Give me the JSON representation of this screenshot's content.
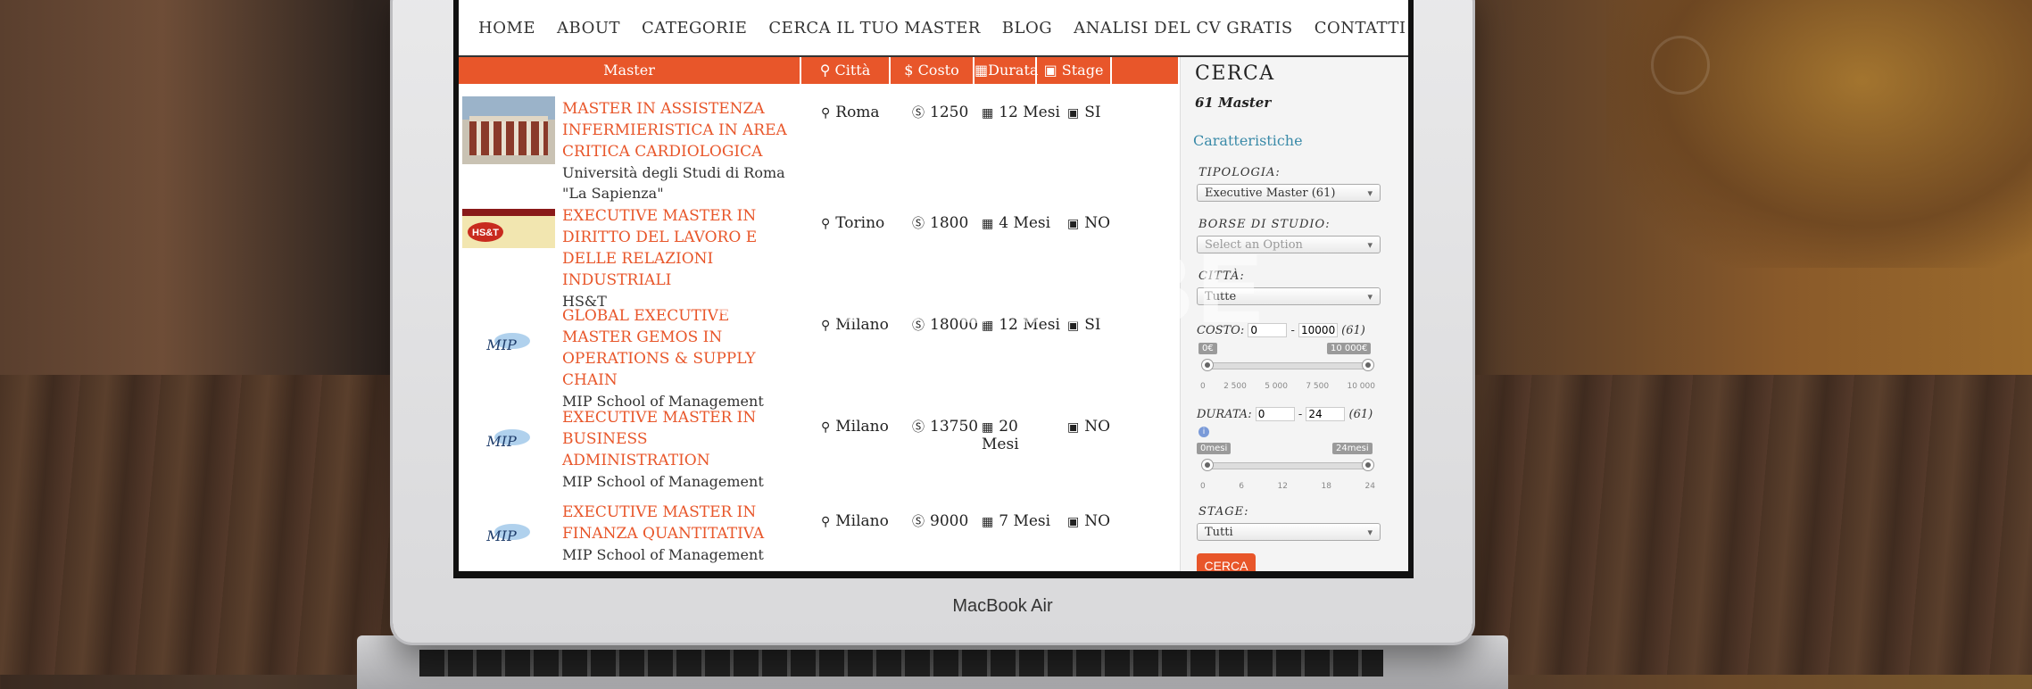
{
  "nav": [
    "HOME",
    "ABOUT",
    "CATEGORIE",
    "CERCA IL TUO MASTER",
    "BLOG",
    "ANALISI DEL CV GRATIS",
    "CONTATTI"
  ],
  "table_header": {
    "master": "Master",
    "city": "Città",
    "cost": "Costo",
    "duration": "Durata",
    "stage": "Stage"
  },
  "rows": [
    {
      "title": "MASTER IN ASSISTENZA INFERMIERISTICA IN AREA CRITICA CARDIOLOGICA",
      "org": "Università degli Studi di Roma \"La Sapienza\"",
      "city": "Roma",
      "cost": "1250",
      "duration": "12 Mesi",
      "stage": "SI",
      "logo": "building-photo"
    },
    {
      "title": "EXECUTIVE MASTER IN DIRITTO DEL LAVORO E DELLE RELAZIONI INDUSTRIALI",
      "org": "HS&T",
      "city": "Torino",
      "cost": "1800",
      "duration": "4 Mesi",
      "stage": "NO",
      "logo": "HS&T"
    },
    {
      "title": "GLOBAL EXECUTIVE MASTER GEMOS IN OPERATIONS & SUPPLY CHAIN",
      "org": "MIP School of Management",
      "city": "Milano",
      "cost": "18000",
      "duration": "12 Mesi",
      "stage": "SI",
      "logo": "MIP"
    },
    {
      "title": "EXECUTIVE MASTER IN BUSINESS ADMINISTRATION",
      "org": "MIP School of Management",
      "city": "Milano",
      "cost": "13750",
      "duration": "20 Mesi",
      "stage": "NO",
      "logo": "MIP"
    },
    {
      "title": "EXECUTIVE MASTER IN FINANZA QUANTITATIVA",
      "org": "MIP School of Management",
      "city": "Milano",
      "cost": "9000",
      "duration": "7 Mesi",
      "stage": "NO",
      "logo": "MIP"
    }
  ],
  "sidebar": {
    "title": "CERCA",
    "count": "61 Master",
    "section": "Caratteristiche",
    "tipologia_label": "TIPOLOGIA:",
    "tipologia_value": "Executive Master (61)",
    "borse_label": "BORSE DI STUDIO:",
    "borse_placeholder": "Select an Option",
    "citta_label": "CITTÀ:",
    "citta_value": "Tutte",
    "costo_label": "COSTO:",
    "costo_min": "0",
    "costo_max": "10000",
    "costo_count": "(61)",
    "costo_bubble_min": "0€",
    "costo_bubble_max": "10 000€",
    "costo_ticks": [
      "0",
      "2 500",
      "5 000",
      "7 500",
      "10 000"
    ],
    "durata_label": "DURATA:",
    "durata_min": "0",
    "durata_max": "24",
    "durata_count": "(61)",
    "durata_bubble_min": "0mesi",
    "durata_bubble_max": "24mesi",
    "durata_ticks": [
      "0",
      "6",
      "12",
      "18",
      "24"
    ],
    "stage_label": "STAGE:",
    "stage_value": "Tutti",
    "button": "CERCA"
  },
  "watermark": "ORCONIBE",
  "brand": "MacBook Air",
  "colors": {
    "accent": "#e8562a",
    "link": "#3a8aa8"
  }
}
